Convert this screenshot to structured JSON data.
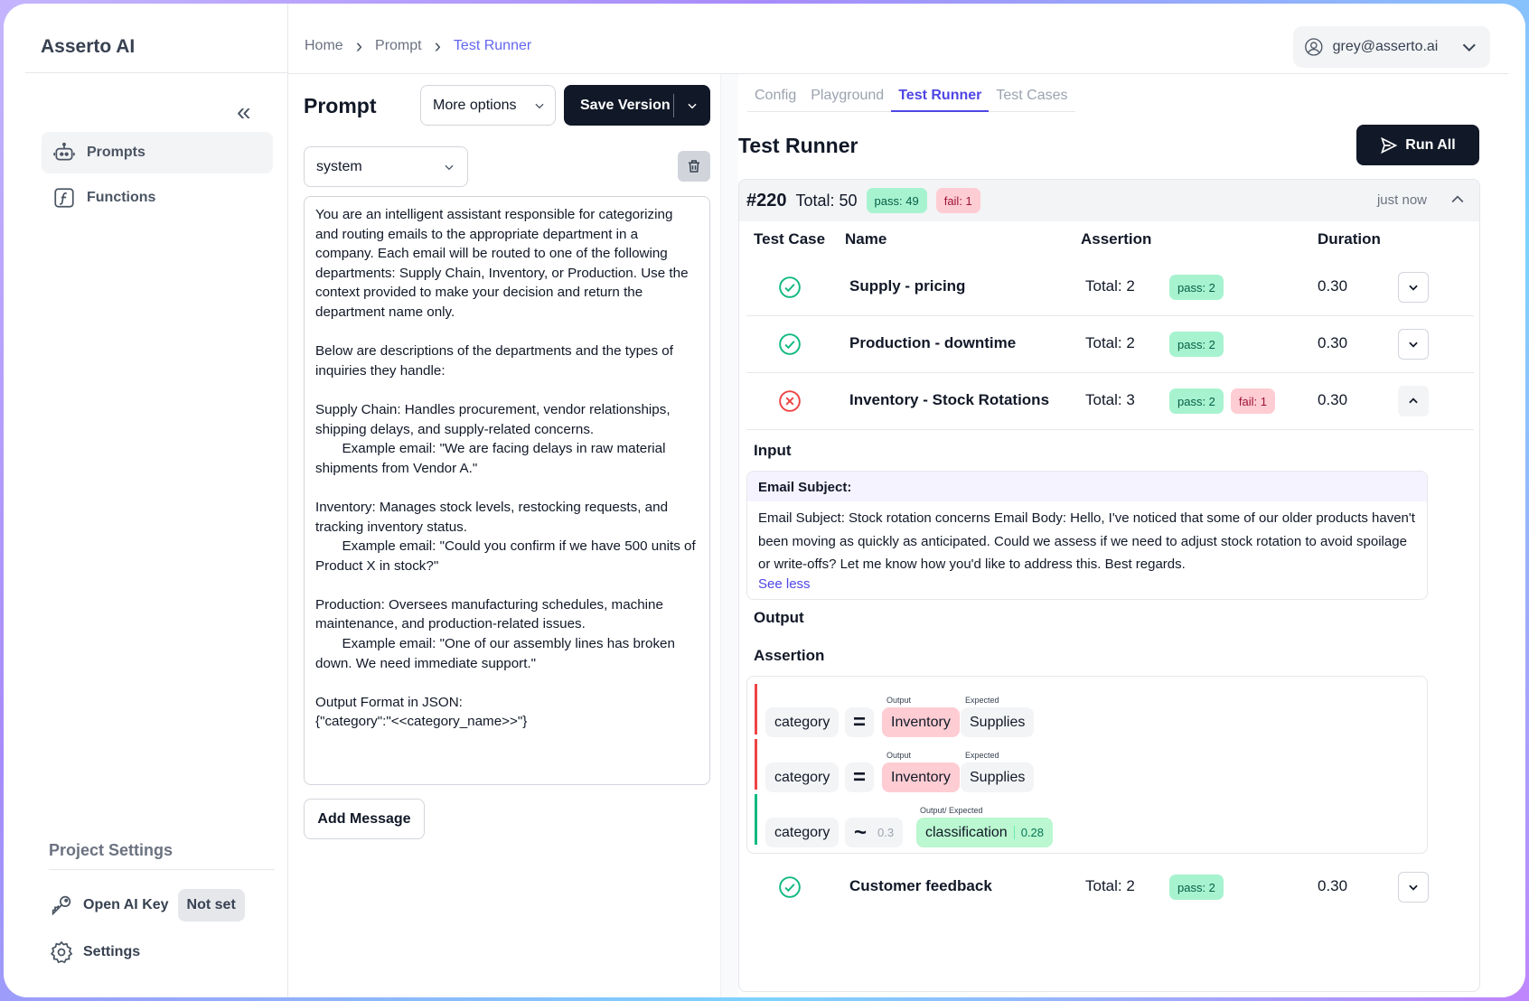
{
  "app": {
    "brand": "Asserto AI"
  },
  "sidebar": {
    "items": [
      {
        "label": "Prompts",
        "icon": "robot-icon"
      },
      {
        "label": "Functions",
        "icon": "function-icon"
      }
    ],
    "project_settings_title": "Project Settings",
    "open_ai_key_label": "Open AI Key",
    "open_ai_key_value": "Not set",
    "settings_label": "Settings"
  },
  "header": {
    "breadcrumb": [
      "Home",
      "Prompt",
      "Test Runner"
    ],
    "user_email": "grey@asserto.ai"
  },
  "prompt_panel": {
    "title": "Prompt",
    "more_options": "More options",
    "save_version": "Save Version",
    "role": "system",
    "text": "You are an intelligent assistant responsible for categorizing and routing emails to the appropriate department in a company. Each email will be routed to one of the following departments: Supply Chain, Inventory, or Production. Use the context provided to make your decision and return the department name only.\n\nBelow are descriptions of the departments and the types of inquiries they handle:\n\nSupply Chain: Handles procurement, vendor relationships, shipping delays, and supply-related concerns.\n       Example email: \"We are facing delays in raw material shipments from Vendor A.\"\n\nInventory: Manages stock levels, restocking requests, and tracking inventory status.\n       Example email: \"Could you confirm if we have 500 units of Product X in stock?\"\n\nProduction: Oversees manufacturing schedules, machine maintenance, and production-related issues.\n       Example email: \"One of our assembly lines has broken down. We need immediate support.\"\n\nOutput Format in JSON:\n{\"category\":\"<<category_name>>\"}",
    "add_message": "Add Message"
  },
  "tabs": [
    "Config",
    "Playground",
    "Test Runner",
    "Test Cases"
  ],
  "active_tab": "Test Runner",
  "runner": {
    "title": "Test Runner",
    "run_all": "Run All",
    "run": {
      "id": "#220",
      "total": "Total: 50",
      "pass": "pass: 49",
      "fail": "fail: 1",
      "time": "just now"
    },
    "columns": [
      "Test Case",
      "Name",
      "Assertion",
      "Duration"
    ],
    "rows": [
      {
        "status": "pass",
        "name": "Supply - pricing",
        "total": "Total: 2",
        "pass": "pass: 2",
        "fail": "",
        "duration": "0.30"
      },
      {
        "status": "pass",
        "name": "Production - downtime",
        "total": "Total: 2",
        "pass": "pass: 2",
        "fail": "",
        "duration": "0.30"
      },
      {
        "status": "fail",
        "name": "Inventory - Stock Rotations",
        "total": "Total: 3",
        "pass": "pass: 2",
        "fail": "fail: 1",
        "duration": "0.30"
      },
      {
        "status": "pass",
        "name": "Customer feedback",
        "total": "Total: 2",
        "pass": "pass: 2",
        "fail": "",
        "duration": "0.30"
      }
    ],
    "detail": {
      "input_label": "Input",
      "email_subject_label": "Email Subject:",
      "email_body": "Email Subject: Stock rotation concerns Email Body: Hello, I've noticed that some of our older products haven't been moving as quickly as anticipated. Could we assess if we need to adjust stock rotation to avoid spoilage or write-offs? Let me know how you'd like to address this. Best regards.",
      "see_less": "See less",
      "output_label": "Output",
      "assertion_label": "Assertion",
      "assertions": [
        {
          "field": "category",
          "op": "=",
          "output_caption": "Output",
          "output": "Inventory",
          "expected_caption": "Expected",
          "expected": "Supplies",
          "result": "fail"
        },
        {
          "field": "category",
          "op": "=",
          "output_caption": "Output",
          "output": "Inventory",
          "expected_caption": "Expected",
          "expected": "Supplies",
          "result": "fail"
        },
        {
          "field": "category",
          "op": "~",
          "threshold": "0.3",
          "caption": "Output/ Expected",
          "value": "classification",
          "score": "0.28",
          "result": "pass"
        }
      ]
    }
  },
  "colors": {
    "accent": "#4f46e5",
    "dark": "#111827",
    "pass_bg": "#a7f3d0",
    "fail_bg": "#fecdd3"
  }
}
